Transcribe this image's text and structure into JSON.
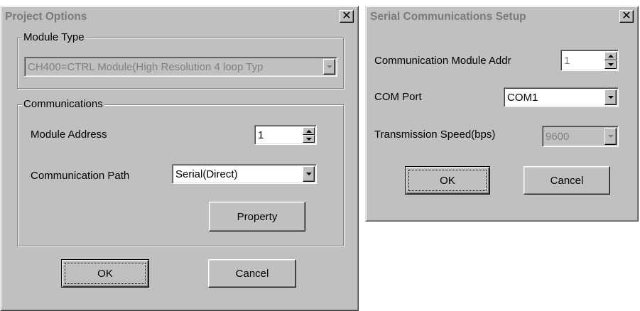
{
  "project_options": {
    "title": "Project Options",
    "close_glyph": "✕",
    "module_type": {
      "group_label": "Module Type",
      "value": "CH400=CTRL Module(High Resolution 4 loop Typ"
    },
    "communications": {
      "group_label": "Communications",
      "module_address_label": "Module Address",
      "module_address_value": "1",
      "path_label": "Communication Path",
      "path_value": "Serial(Direct)",
      "property_label": "Property"
    },
    "ok_label": "OK",
    "cancel_label": "Cancel"
  },
  "serial_setup": {
    "title": "Serial Communications Setup",
    "close_glyph": "✕",
    "module_addr_label": "Communication Module Addr",
    "module_addr_value": "1",
    "com_port_label": "COM Port",
    "com_port_value": "COM1",
    "speed_label": "Transmission Speed(bps)",
    "speed_value": "9600",
    "ok_label": "OK",
    "cancel_label": "Cancel"
  }
}
